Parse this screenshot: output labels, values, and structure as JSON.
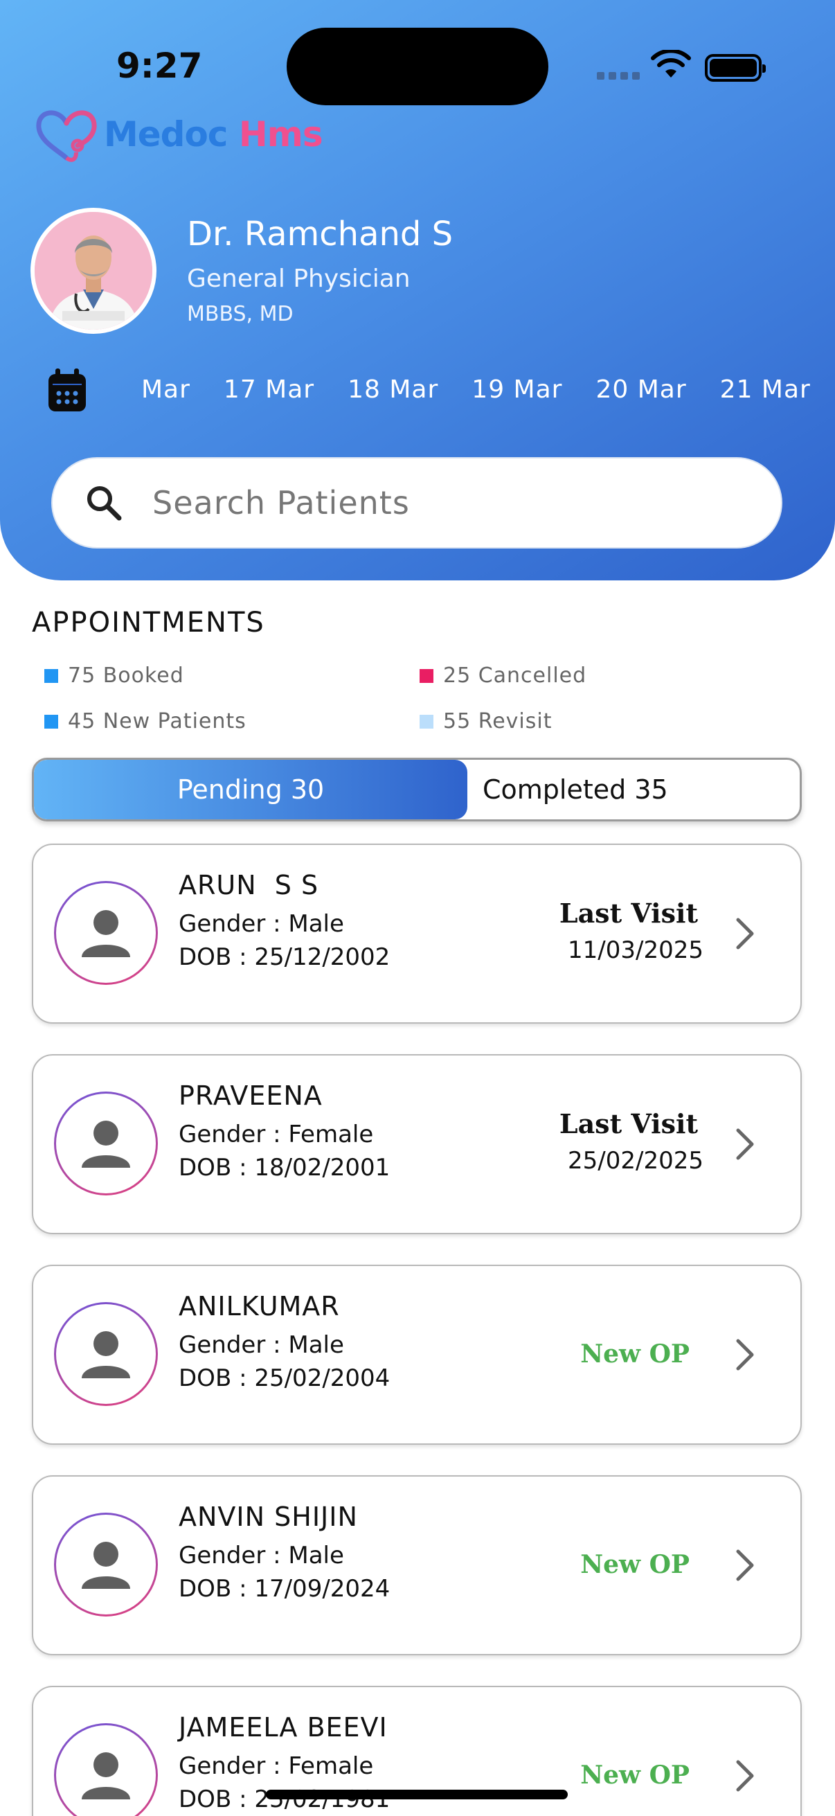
{
  "status_bar": {
    "time": "9:27"
  },
  "brand": {
    "part1": "Medoc",
    "part2": "Hms"
  },
  "doctor": {
    "name": "Dr. Ramchand S",
    "specialty": "General Physician",
    "qualification": "MBBS, MD"
  },
  "dates": [
    "Mar",
    "17 Mar",
    "18 Mar",
    "19 Mar",
    "20 Mar",
    "21 Mar"
  ],
  "search": {
    "placeholder": "Search Patients"
  },
  "appointments": {
    "title": "APPOINTMENTS",
    "legend": [
      {
        "label": "75 Booked",
        "color": "#2196f3"
      },
      {
        "label": "25 Cancelled",
        "color": "#e91e63"
      },
      {
        "label": "45 New Patients",
        "color": "#2196f3"
      },
      {
        "label": "55 Revisit",
        "color": "#bbdefb"
      }
    ],
    "tabs": {
      "pending": "Pending 30",
      "completed": "Completed 35"
    }
  },
  "patients": [
    {
      "name": "ARUN  S S",
      "gender": "Gender : Male",
      "dob": "DOB : 25/12/2002",
      "last_visit_label": "Last Visit",
      "last_visit_date": "11/03/2025"
    },
    {
      "name": "PRAVEENA",
      "gender": "Gender : Female",
      "dob": "DOB : 18/02/2001",
      "last_visit_label": "Last Visit",
      "last_visit_date": "25/02/2025"
    },
    {
      "name": "ANILKUMAR",
      "gender": "Gender : Male",
      "dob": "DOB : 25/02/2004",
      "status": "New OP"
    },
    {
      "name": "ANVIN SHIJIN",
      "gender": "Gender : Male",
      "dob": "DOB : 17/09/2024",
      "status": "New OP"
    },
    {
      "name": "JAMEELA BEEVI",
      "gender": "Gender : Female",
      "dob": "DOB : 25/02/1981",
      "status": "New OP"
    }
  ]
}
